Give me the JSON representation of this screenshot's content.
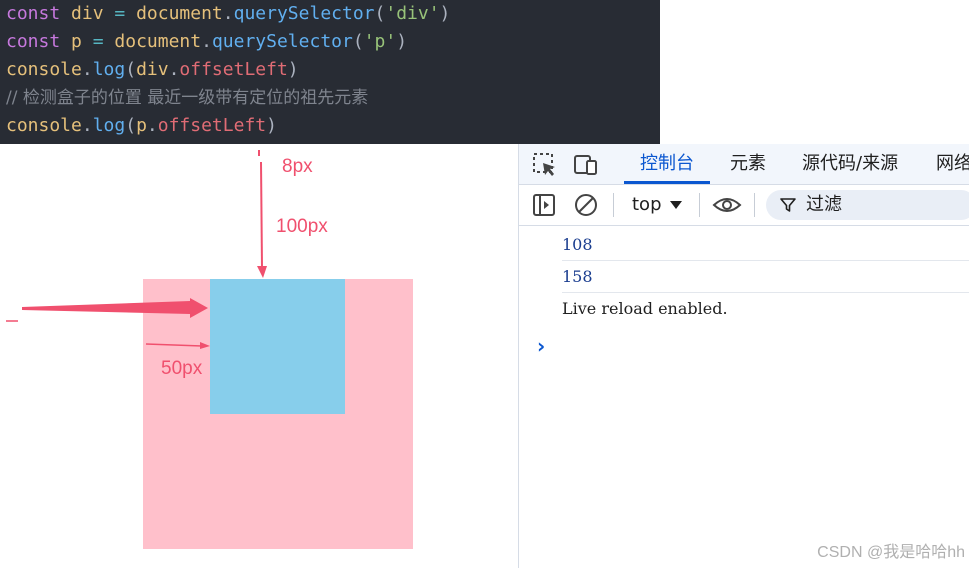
{
  "code": {
    "line1": {
      "kw": "const",
      "name": "div",
      "eq": "=",
      "obj": "document",
      "dot": ".",
      "fn": "querySelector",
      "open": "(",
      "arg": "'div'",
      "close": ")"
    },
    "line2": {
      "kw": "const",
      "name": "p",
      "eq": "=",
      "obj": "document",
      "dot": ".",
      "fn": "querySelector",
      "open": "(",
      "arg": "'p'",
      "close": ")"
    },
    "line3": {
      "obj": "console",
      "dot": ".",
      "fn": "log",
      "open": "(",
      "target": "div",
      "dot2": ".",
      "prop": "offsetLeft",
      "close": ")"
    },
    "line4": {
      "comment": "// 检测盒子的位置 最近一级带有定位的祖先元素"
    },
    "line5": {
      "obj": "console",
      "dot": ".",
      "fn": "log",
      "open": "(",
      "target": "p",
      "dot2": ".",
      "prop": "offsetLeft",
      "close": ")"
    }
  },
  "annotations": {
    "top_margin": "8px",
    "outer_offset": "100px",
    "inner_offset": "50px"
  },
  "colors": {
    "outer_box": "#ffc0cb",
    "inner_box": "#87ceeb",
    "annotation": "#f0506e",
    "devtools_accent": "#0b57d0"
  },
  "devtools": {
    "tabs": [
      "控制台",
      "元素",
      "源代码/来源",
      "网络"
    ],
    "active_tab": "控制台",
    "context": "top",
    "filter_label": "过滤",
    "messages": [
      "108",
      "158",
      "Live reload enabled."
    ],
    "prompt": "›",
    "icons": [
      "inspect-element-icon",
      "device-toolbar-icon",
      "sidebar-toggle-icon",
      "clear-console-icon",
      "eye-icon",
      "filter-icon"
    ]
  },
  "watermark": "CSDN @我是哈哈hh"
}
